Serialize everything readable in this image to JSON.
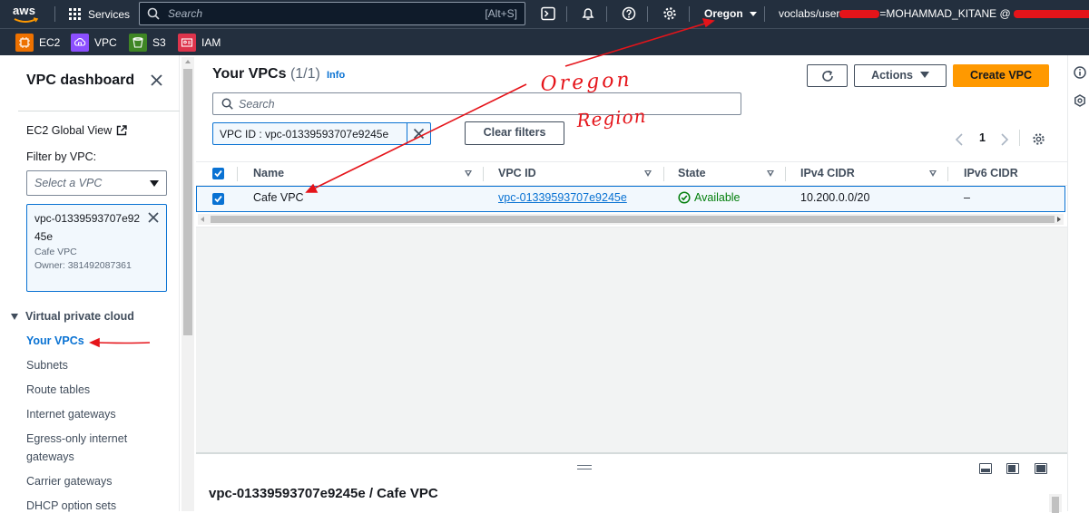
{
  "topbar": {
    "logo_text": "aws",
    "services_label": "Services",
    "search_placeholder": "Search",
    "search_shortcut": "[Alt+S]",
    "region_label": "Oregon",
    "account_prefix": "voclabs/user",
    "account_middle": "=MOHAMMAD_KITANE @",
    "icons": [
      "cloudshell-icon",
      "bell-icon",
      "help-icon",
      "gear-icon"
    ]
  },
  "favorites": [
    {
      "label": "EC2",
      "color": "#ed7100"
    },
    {
      "label": "VPC",
      "color": "#8c4fff"
    },
    {
      "label": "S3",
      "color": "#3f8624"
    },
    {
      "label": "IAM",
      "color": "#dd344c"
    }
  ],
  "sidebar": {
    "title": "VPC dashboard",
    "ec2_global_view": "EC2 Global View",
    "filter_label": "Filter by VPC:",
    "select_placeholder": "Select a VPC",
    "token": {
      "vpc_id": "vpc-01339593707e9245e",
      "name": "Cafe VPC",
      "owner": "Owner: 381492087361"
    },
    "section_title": "Virtual private cloud",
    "items": [
      {
        "label": "Your VPCs",
        "active": true
      },
      {
        "label": "Subnets"
      },
      {
        "label": "Route tables"
      },
      {
        "label": "Internet gateways"
      },
      {
        "label": "Egress-only internet gateways"
      },
      {
        "label": "Carrier gateways"
      },
      {
        "label": "DHCP option sets"
      }
    ]
  },
  "main": {
    "heading": "Your VPCs",
    "count": "(1/1)",
    "info_label": "Info",
    "refresh_icon": "refresh-icon",
    "actions_label": "Actions",
    "create_label": "Create VPC",
    "search_placeholder": "Search",
    "filter_token": "VPC ID : vpc-01339593707e9245e",
    "clear_filters": "Clear filters",
    "page": "1",
    "columns": [
      "Name",
      "VPC ID",
      "State",
      "IPv4 CIDR",
      "IPv6 CIDR"
    ],
    "rows": [
      {
        "name": "Cafe VPC",
        "vpc_id": "vpc-01339593707e9245e",
        "state": "Available",
        "ipv4": "10.200.0.0/20",
        "ipv6": "–",
        "selected": true
      }
    ],
    "detail_title": "vpc-01339593707e9245e / Cafe VPC"
  },
  "annotation": {
    "line1": "Oregon",
    "line2": "Region",
    "color": "#e5141a"
  }
}
